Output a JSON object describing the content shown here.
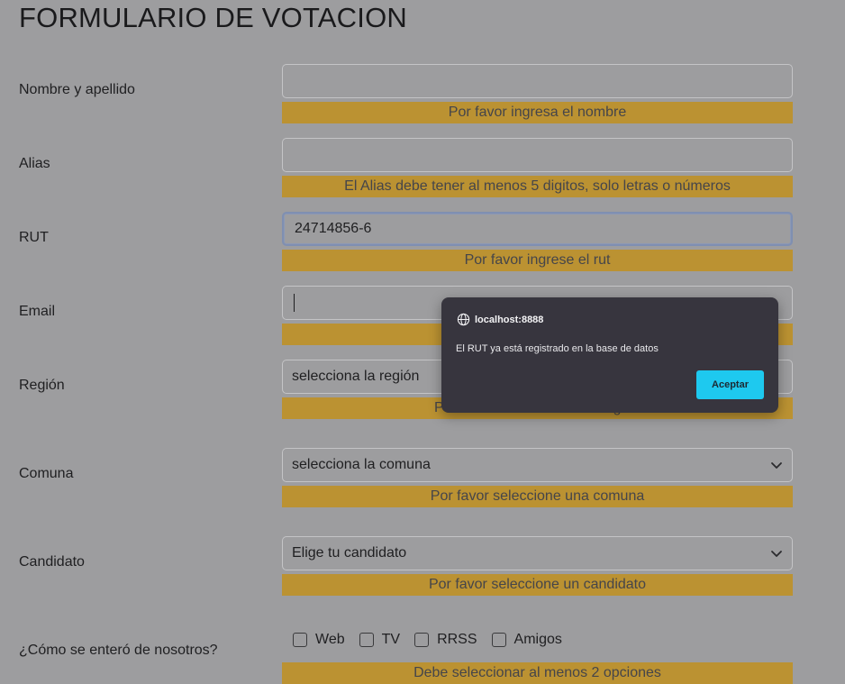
{
  "form": {
    "title": "FORMULARIO DE VOTACION",
    "nombre": {
      "label": "Nombre y apellido",
      "value": "",
      "error": "Por favor ingresa el nombre"
    },
    "alias": {
      "label": "Alias",
      "value": "",
      "error": "El Alias debe tener al menos 5 digitos, solo letras o números"
    },
    "rut": {
      "label": "RUT",
      "value": "24714856-6",
      "error": "Por favor ingrese el rut"
    },
    "email": {
      "label": "Email",
      "value": ""
    },
    "region": {
      "label": "Región",
      "selected": "selecciona la región",
      "error_visible_fragment_left": "P",
      "error_visible_fragment_right": "g"
    },
    "comuna": {
      "label": "Comuna",
      "selected": "selecciona la comuna",
      "error": "Por favor seleccione una comuna"
    },
    "candidato": {
      "label": "Candidato",
      "selected": "Elige tu candidato",
      "error": "Por favor seleccione un candidato"
    },
    "fuente": {
      "label": "¿Cómo se enteró de nosotros?",
      "options": [
        "Web",
        "TV",
        "RRSS",
        "Amigos"
      ],
      "error": "Debe seleccionar al menos 2 opciones"
    }
  },
  "dialog": {
    "origin": "localhost:8888",
    "message": "El RUT ya está registrado en la base de datos",
    "accept_label": "Aceptar"
  },
  "colors": {
    "background": "#9d9d9f",
    "error_bar": "#bb9232",
    "dialog_bg": "#37353e",
    "accept_button": "#1ec9ef"
  }
}
